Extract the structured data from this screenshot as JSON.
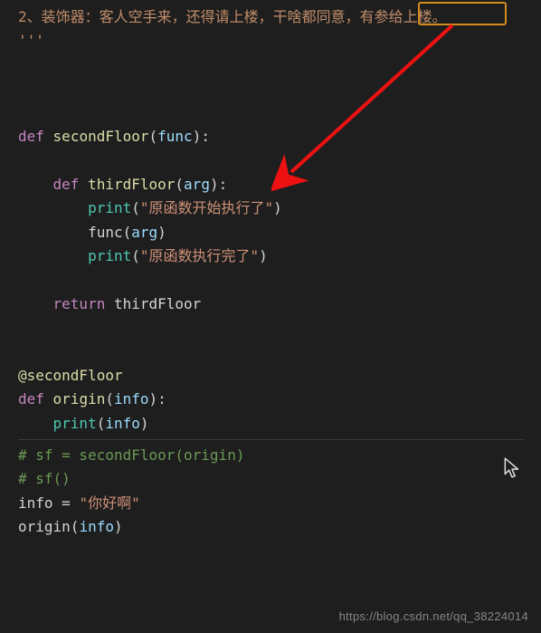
{
  "commentLine": "2、装饰器：客人空手来，还得请上楼，干啥都同意，有参给上楼。",
  "tripleQuote": "'''",
  "highlightText": "有参给上楼",
  "code": {
    "kw_def": "def",
    "kw_return": "return",
    "fn_secondFloor": "secondFloor",
    "fn_thirdFloor": "thirdFloor",
    "fn_origin": "origin",
    "builtin_print": "print",
    "param_func": "func",
    "param_arg": "arg",
    "param_info": "info",
    "open_paren": "(",
    "close_paren": ")",
    "colon": ":",
    "decorator_at": "@secondFloor",
    "str_start_exec": "\"原函数开始执行了\"",
    "str_done_exec": "\"原函数执行完了\"",
    "str_hello": "\"你好啊\"",
    "assign_eq": " = ",
    "ident_info": "info",
    "ident_origin": "origin",
    "ident_thirdFloor_return": "thirdFloor",
    "comment_sf1": "# sf = secondFloor(origin)",
    "comment_sf2": "# sf()"
  },
  "watermark": "https://blog.csdn.net/qq_38224014",
  "annotations": {
    "highlight_box_name": "highlight-box",
    "arrow_name": "red-arrow",
    "cursor_name": "mouse-cursor"
  }
}
